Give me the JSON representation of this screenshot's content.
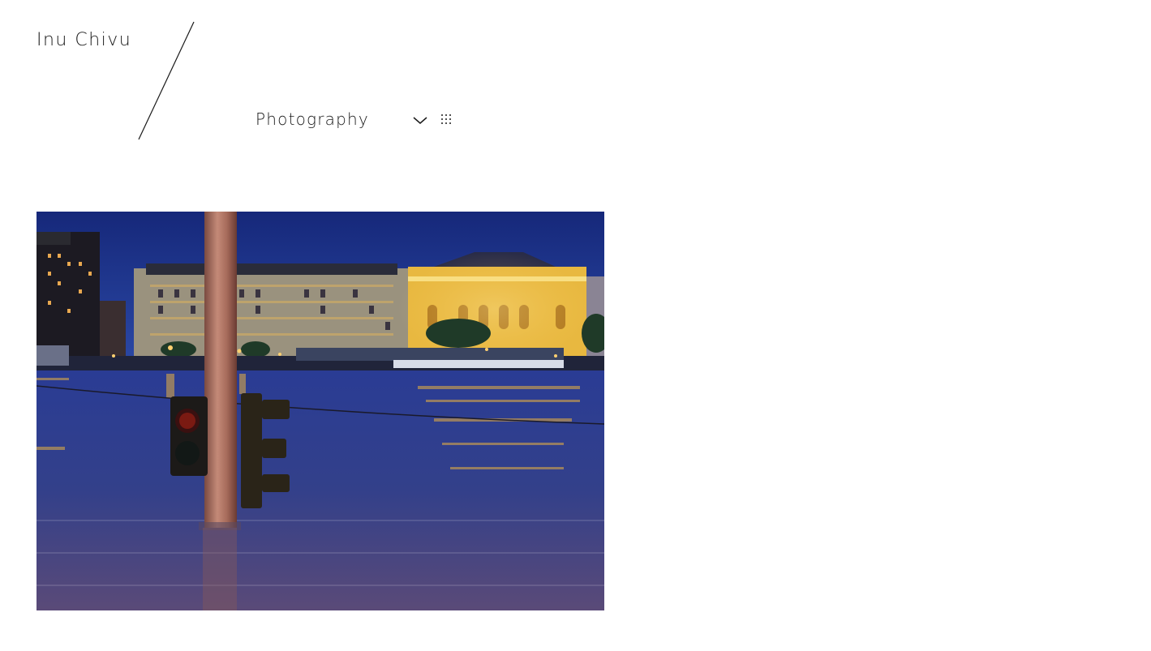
{
  "header": {
    "site_title": "Inu Chivu"
  },
  "nav": {
    "section_label": "Photography"
  },
  "colors": {
    "text": "#1a1a1a",
    "background": "#ffffff",
    "sky": "#1f3a8c",
    "water": "#2e3f8a",
    "lights": "#f5c84a"
  },
  "icons": {
    "dropdown": "chevron-down-icon",
    "menu": "dots-grid-icon"
  }
}
